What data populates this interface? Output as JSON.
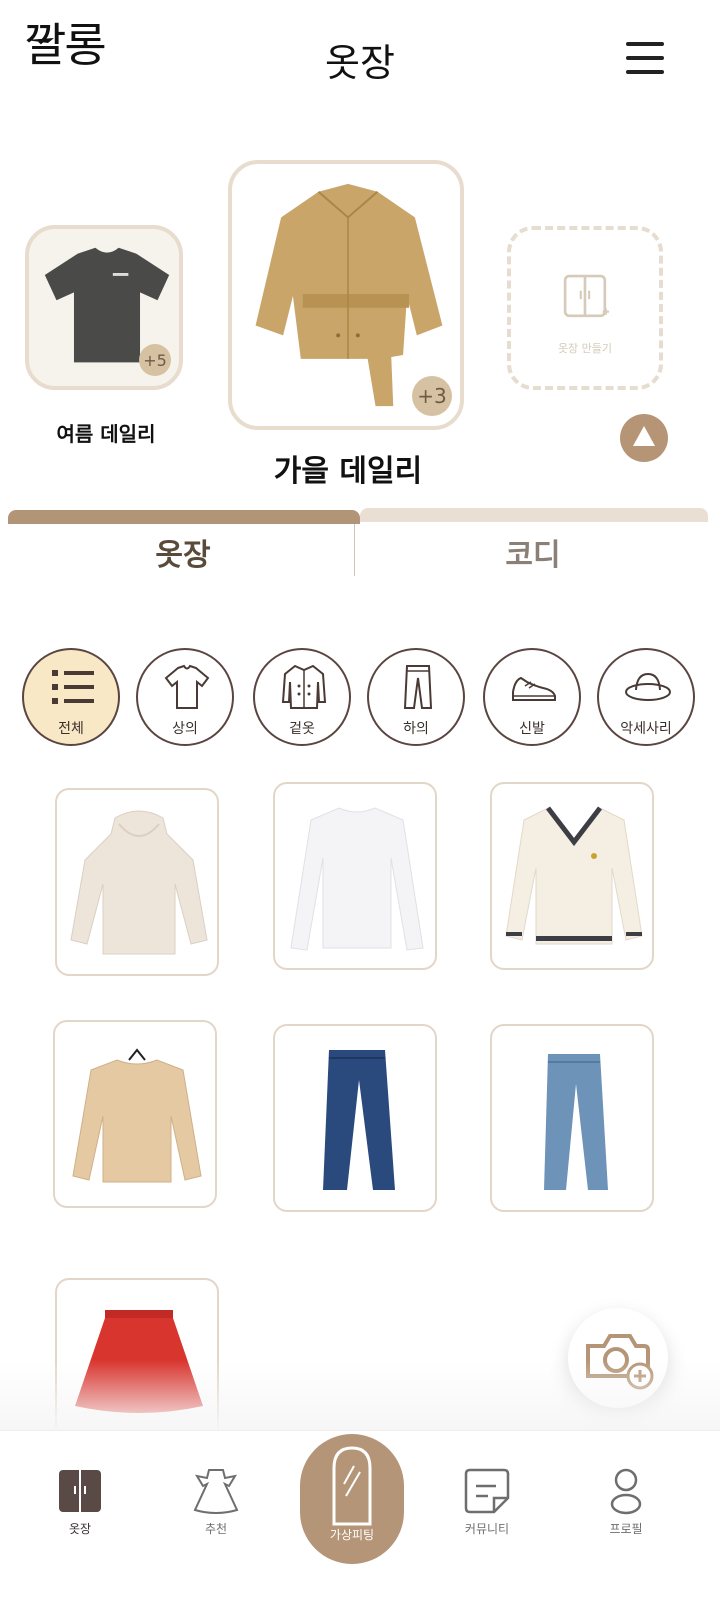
{
  "header": {
    "logo_text": "깔롱",
    "title": "옷장"
  },
  "wardrobes": {
    "left": {
      "label": "여름 데일리",
      "count": "+5"
    },
    "center": {
      "label": "가을 데일리",
      "count": "+3"
    },
    "create_label": "옷장 만들기"
  },
  "tabs": [
    {
      "label": "옷장",
      "active": true
    },
    {
      "label": "코디",
      "active": false
    }
  ],
  "categories": [
    {
      "label": "전체",
      "icon": "list-icon"
    },
    {
      "label": "상의",
      "icon": "tshirt-icon"
    },
    {
      "label": "겉옷",
      "icon": "coat-icon"
    },
    {
      "label": "하의",
      "icon": "pants-icon"
    },
    {
      "label": "신발",
      "icon": "sneaker-icon"
    },
    {
      "label": "악세사리",
      "icon": "hat-icon"
    }
  ],
  "items": [
    {
      "kind": "hoodie",
      "color": "#eee5da"
    },
    {
      "kind": "long-sleeve-tee",
      "color": "#f4f4f6"
    },
    {
      "kind": "cable-knit-sweater",
      "color": "#f4efe2"
    },
    {
      "kind": "knit-sweater",
      "color": "#e5c9a3"
    },
    {
      "kind": "jeans",
      "color": "#2a4a7e"
    },
    {
      "kind": "jeans",
      "color": "#6e93b8"
    },
    {
      "kind": "skirt",
      "color": "#d9352f"
    }
  ],
  "bottom_nav": [
    {
      "label": "옷장",
      "icon": "wardrobe-icon"
    },
    {
      "label": "추천",
      "icon": "dress-icon"
    },
    {
      "label": "가상피팅",
      "icon": "mirror-icon"
    },
    {
      "label": "커뮤니티",
      "icon": "note-icon"
    },
    {
      "label": "프로필",
      "icon": "person-icon"
    }
  ],
  "colors": {
    "accent": "#b59576",
    "tab_active": "#b29577",
    "tab_inactive": "#e9dfd3",
    "category_active_bg": "#f8e8c6"
  }
}
